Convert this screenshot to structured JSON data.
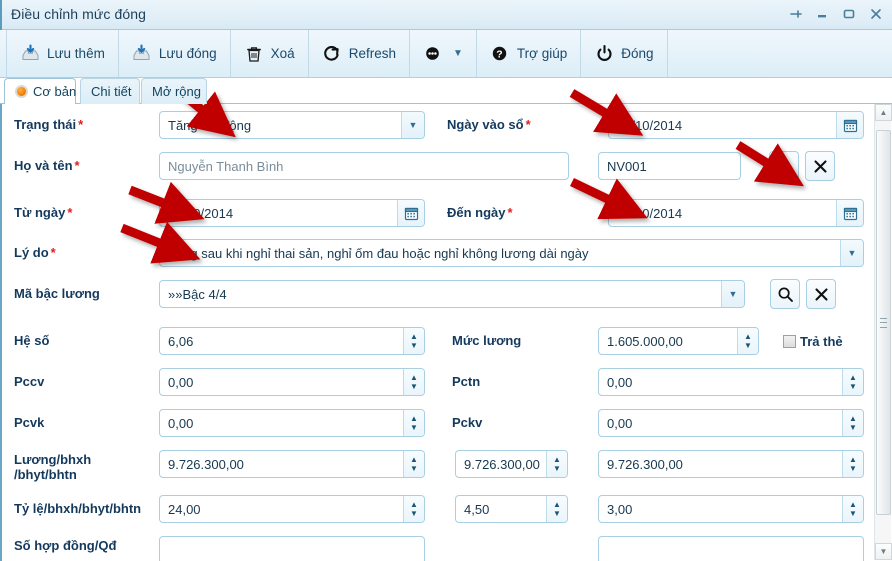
{
  "window": {
    "title": "Điều chỉnh mức đóng",
    "controls": [
      {
        "name": "pin-icon",
        "label": "Pin"
      },
      {
        "name": "minimize-icon",
        "label": "Minimize"
      },
      {
        "name": "maximize-icon",
        "label": "Maximize"
      },
      {
        "name": "close-icon",
        "label": "Close"
      }
    ]
  },
  "toolbar": {
    "save_add_label": "Lưu thêm",
    "save_close_label": "Lưu đóng",
    "delete_label": "Xoá",
    "refresh_label": "Refresh",
    "more_label": "",
    "help_label": "Trợ giúp",
    "close_label": "Đóng"
  },
  "tabs": [
    {
      "label": "Cơ bản",
      "active": true
    },
    {
      "label": "Chi tiết",
      "active": false
    },
    {
      "label": "Mở rộng",
      "active": false
    }
  ],
  "form": {
    "trang_thai": {
      "label": "Trạng thái",
      "required": "*",
      "value": "Tăng lao động"
    },
    "ngay_vao_so": {
      "label": "Ngày vào sổ",
      "required": "*",
      "value": "15/10/2014"
    },
    "ho_va_ten": {
      "label": "Họ và tên",
      "required": "*",
      "value": "Nguyễn Thanh Bình"
    },
    "ma_nhan_vien": {
      "value": "NV001"
    },
    "tu_ngay": {
      "label": "Từ ngày",
      "required": "*",
      "value": "15/10/2014"
    },
    "den_ngay": {
      "label": "Đến ngày",
      "required": "*",
      "value": "22/10/2014"
    },
    "ly_do": {
      "label": "Lý do",
      "required": "*",
      "value": "Tăng sau khi nghỉ thai sản, nghỉ ốm đau hoặc nghỉ không lương dài ngày"
    },
    "ma_bac_luong": {
      "label": "Mã bậc lương",
      "required": "",
      "value": "»»Bậc 4/4"
    },
    "he_so": {
      "label": "Hệ số",
      "required": "",
      "value": "6,06"
    },
    "muc_luong": {
      "label": "Mức lương",
      "required": "",
      "value": "1.605.000,00"
    },
    "tra_the": {
      "label": "Trả thẻ",
      "checked": false
    },
    "pccv": {
      "label": "Pccv",
      "value": "0,00"
    },
    "pctn": {
      "label": "Pctn",
      "value": "0,00"
    },
    "pcvk": {
      "label": "Pcvk",
      "value": "0,00"
    },
    "pckv": {
      "label": "Pckv",
      "value": "0,00"
    },
    "luong_bhxh": {
      "label_line1": "Lương/bhxh",
      "label_line2": "/bhyt/bhtn",
      "value1": "9.726.300,00",
      "value2": "9.726.300,00",
      "value3": "9.726.300,00"
    },
    "ty_le_bhxh": {
      "label": "Tỷ lệ/bhxh/bhyt/bhtn",
      "value1": "24,00",
      "value2": "4,50",
      "value3": "3,00"
    },
    "so_hop_dong": {
      "label": "Số hợp đồng/Qđ",
      "value": ""
    }
  },
  "icon_buttons": {
    "search_employee": "search-icon",
    "clear_employee": "clear-x-icon",
    "search_bac_luong": "search-icon",
    "clear_bac_luong": "clear-x-icon"
  },
  "annotations": {
    "color": "#c00000",
    "arrows": [
      {
        "name": "arrow-to-trang-thai"
      },
      {
        "name": "arrow-to-ngay-vao-so"
      },
      {
        "name": "arrow-to-search-employee"
      },
      {
        "name": "arrow-to-tu-ngay"
      },
      {
        "name": "arrow-to-den-ngay"
      },
      {
        "name": "arrow-to-ly-do"
      }
    ]
  },
  "scrollbar": {
    "name": "vertical-scrollbar"
  }
}
